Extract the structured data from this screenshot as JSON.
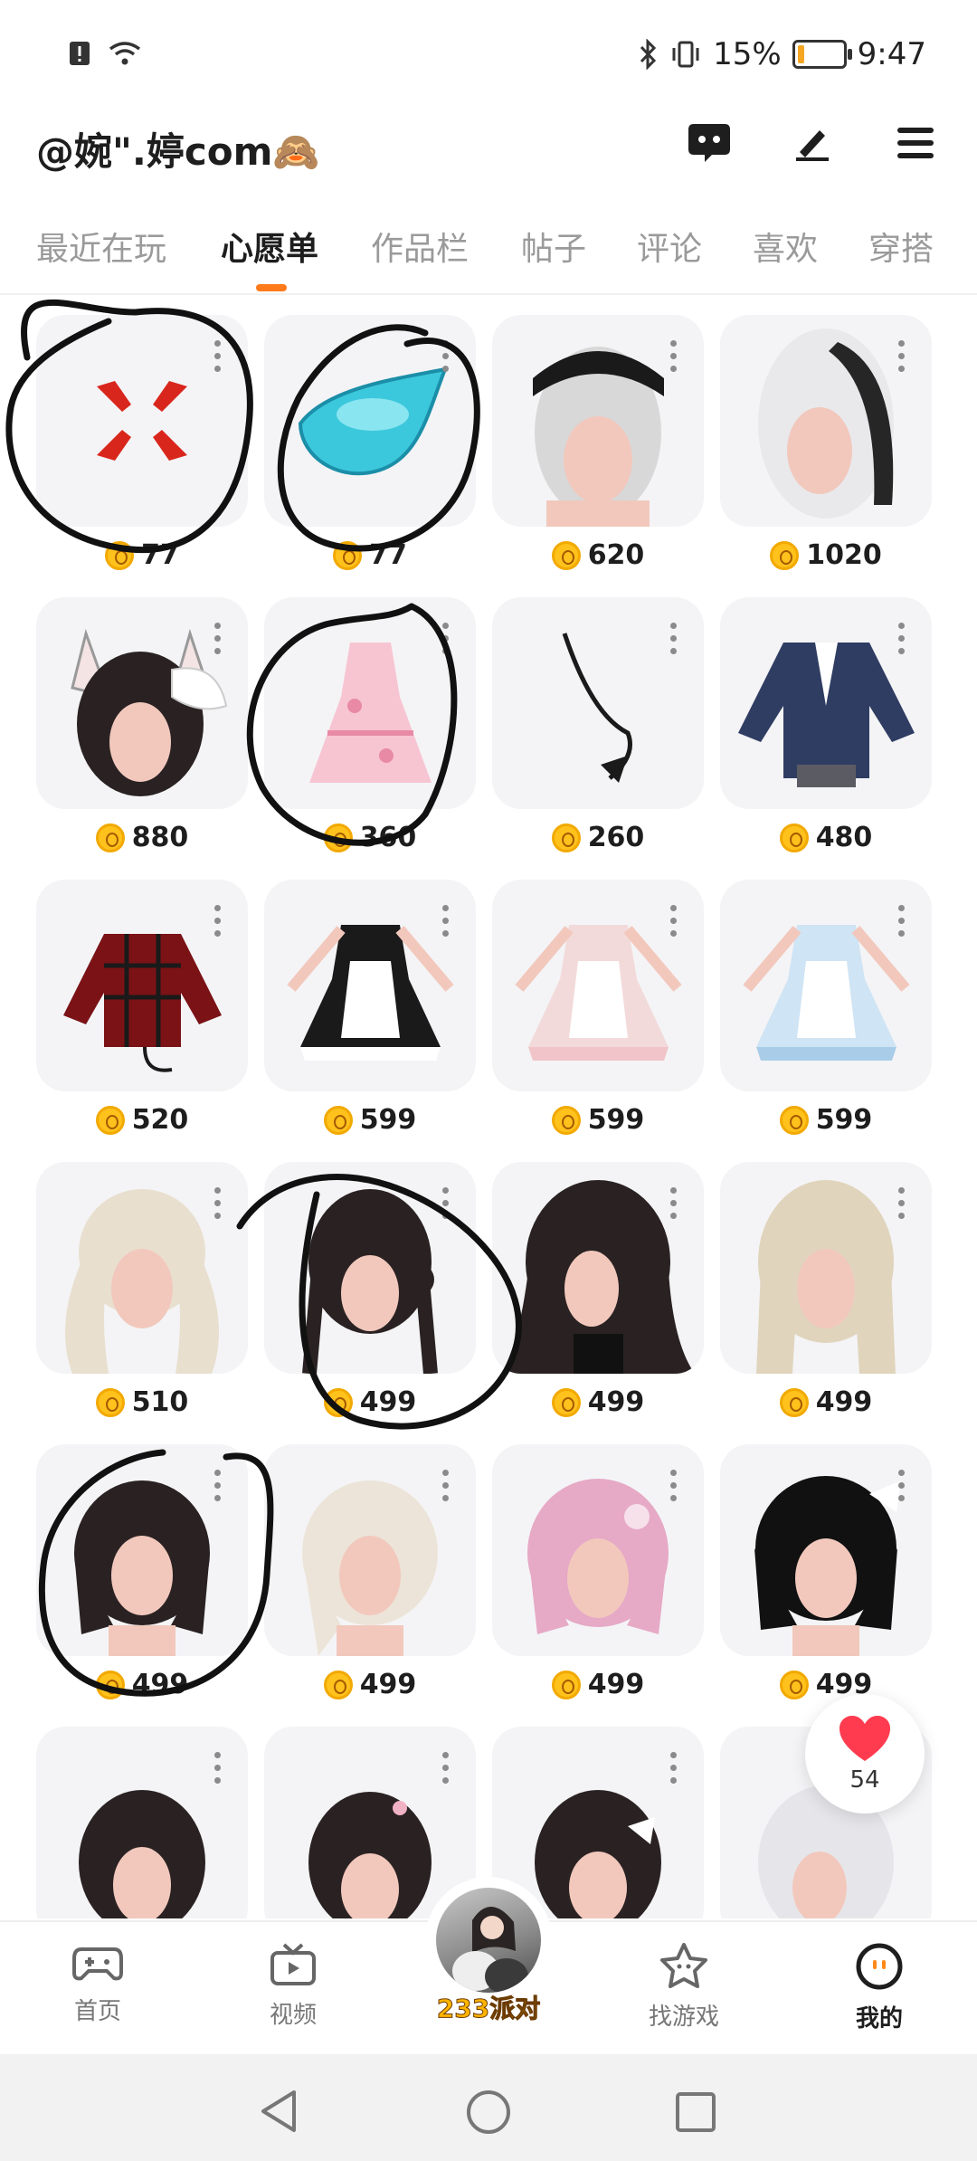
{
  "status_bar": {
    "battery": "15%",
    "time": "9:47"
  },
  "header": {
    "username": "@婉\".婷com🙈"
  },
  "tabs": [
    {
      "label": "最近在玩"
    },
    {
      "label": "心愿单"
    },
    {
      "label": "作品栏"
    },
    {
      "label": "帖子"
    },
    {
      "label": "评论"
    },
    {
      "label": "喜欢"
    },
    {
      "label": "穿搭"
    }
  ],
  "active_tab": "心愿单",
  "wishlist": [
    {
      "price": "77",
      "art": "anger-emoji"
    },
    {
      "price": "77",
      "art": "water-drop"
    },
    {
      "price": "620",
      "art": "maid-hair-white"
    },
    {
      "price": "1020",
      "art": "white-black-hair"
    },
    {
      "price": "880",
      "art": "catear-hair"
    },
    {
      "price": "360",
      "art": "pink-dress"
    },
    {
      "price": "260",
      "art": "tail-accessory"
    },
    {
      "price": "480",
      "art": "blue-jacket"
    },
    {
      "price": "520",
      "art": "red-plaid-top"
    },
    {
      "price": "599",
      "art": "black-maid-dress"
    },
    {
      "price": "599",
      "art": "pink-maid-dress"
    },
    {
      "price": "599",
      "art": "blue-maid-dress"
    },
    {
      "price": "510",
      "art": "blonde-twintails"
    },
    {
      "price": "499",
      "art": "black-hair-bun"
    },
    {
      "price": "499",
      "art": "black-long-hair"
    },
    {
      "price": "499",
      "art": "blonde-long-hair"
    },
    {
      "price": "499",
      "art": "black-bob"
    },
    {
      "price": "499",
      "art": "blonde-bob"
    },
    {
      "price": "499",
      "art": "pink-bob"
    },
    {
      "price": "499",
      "art": "black-bob-ribbon"
    },
    {
      "price": "",
      "art": "black-curly-hair"
    },
    {
      "price": "",
      "art": "black-pigtails"
    },
    {
      "price": "",
      "art": "black-hair-ribbon"
    },
    {
      "price": "",
      "art": "white-hair"
    }
  ],
  "like_fab": {
    "count": "54"
  },
  "bottom_nav": [
    {
      "label": "首页",
      "icon": "gamepad-icon"
    },
    {
      "label": "视频",
      "icon": "tv-icon"
    },
    {
      "label": "233派对",
      "icon": "party-avatar"
    },
    {
      "label": "找游戏",
      "icon": "star-face-icon"
    },
    {
      "label": "我的",
      "icon": "profile-face-icon"
    }
  ],
  "colors": {
    "accent": "#ff7a1a",
    "coin": "#ffc21c",
    "like": "#ff3b4f"
  }
}
